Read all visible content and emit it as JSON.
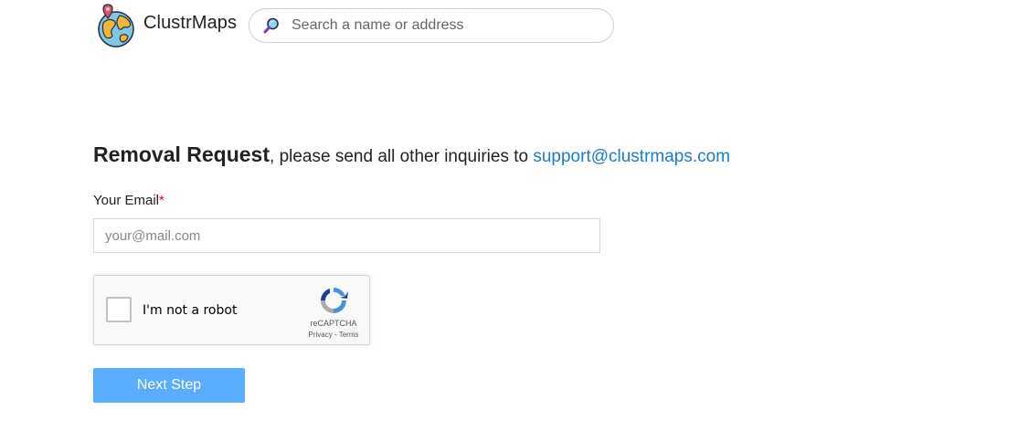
{
  "header": {
    "brand": "ClustrMaps",
    "search": {
      "placeholder": "Search a name or address",
      "value": ""
    }
  },
  "heading": {
    "title": "Removal Request",
    "text": ", please send all other inquiries to ",
    "email": "support@clustrmaps.com"
  },
  "form": {
    "email_label": "Your Email",
    "required_mark": "*",
    "email_placeholder": "your@mail.com",
    "email_value": "",
    "next_label": "Next Step"
  },
  "captcha": {
    "label": "I'm not a robot",
    "brand": "reCAPTCHA",
    "privacy": "Privacy",
    "separator": " - ",
    "terms": "Terms",
    "checked": false
  },
  "icons": {
    "logo": "globe-pin-icon",
    "search": "magnifier-icon",
    "captcha": "recaptcha-icon"
  },
  "colors": {
    "link": "#1a7cc9",
    "button": "#5aacff",
    "required": "#d0021b"
  }
}
